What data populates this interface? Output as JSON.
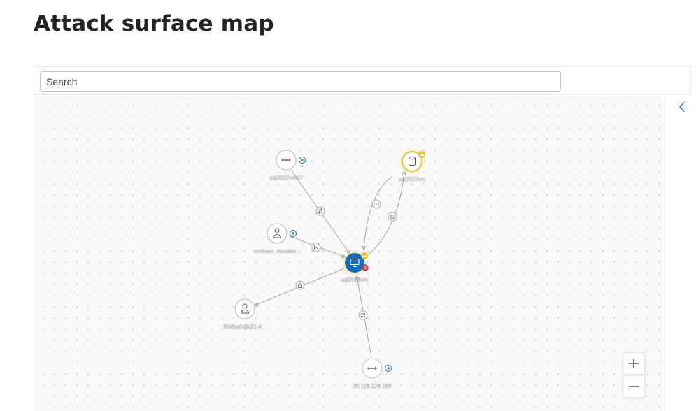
{
  "page": {
    "title": "Attack surface map"
  },
  "search": {
    "placeholder": "Search",
    "value": ""
  },
  "graph": {
    "nodes": [
      {
        "id": "n1",
        "label": "sql2022vm07",
        "icon": "ip-address-icon",
        "badge": "expand-icon"
      },
      {
        "id": "n2",
        "label": "sql2022vm",
        "icon": "database-icon",
        "badge": "crown-jewel-icon"
      },
      {
        "id": "n3",
        "label": "contoso_cloudde...",
        "icon": "user-icon",
        "badge": "expand-icon"
      },
      {
        "id": "n4",
        "label": "sql2022vm",
        "icon": "virtual-machine-icon",
        "badge": "crown-jewel-icon"
      },
      {
        "id": "n5",
        "label": "fb5f0a0-8b21-4...",
        "icon": "user-icon"
      },
      {
        "id": "n6",
        "label": "20.119.224.189",
        "icon": "ip-address-icon",
        "badge": "expand-icon"
      }
    ],
    "edges": [
      {
        "from": "n1",
        "to": "n4",
        "icon": "routes-to-icon"
      },
      {
        "from": "n2",
        "to": "n4",
        "icon": "more-icon"
      },
      {
        "from": "n4",
        "to": "n2",
        "icon": "permission-icon"
      },
      {
        "from": "n3",
        "to": "n4",
        "icon": "identity-icon"
      },
      {
        "from": "n4",
        "to": "n5",
        "icon": "lock-icon"
      },
      {
        "from": "n6",
        "to": "n4",
        "icon": "routes-to-icon"
      }
    ],
    "colors": {
      "vm_node": "#0f6cbd",
      "crown_badge": "#e5c33a",
      "alert_badge": "#d13438",
      "expand_badge": "#0f6cbd",
      "edge": "#a8a8a8"
    }
  },
  "zoom": {
    "in_symbol": "+",
    "out_symbol": "−"
  }
}
